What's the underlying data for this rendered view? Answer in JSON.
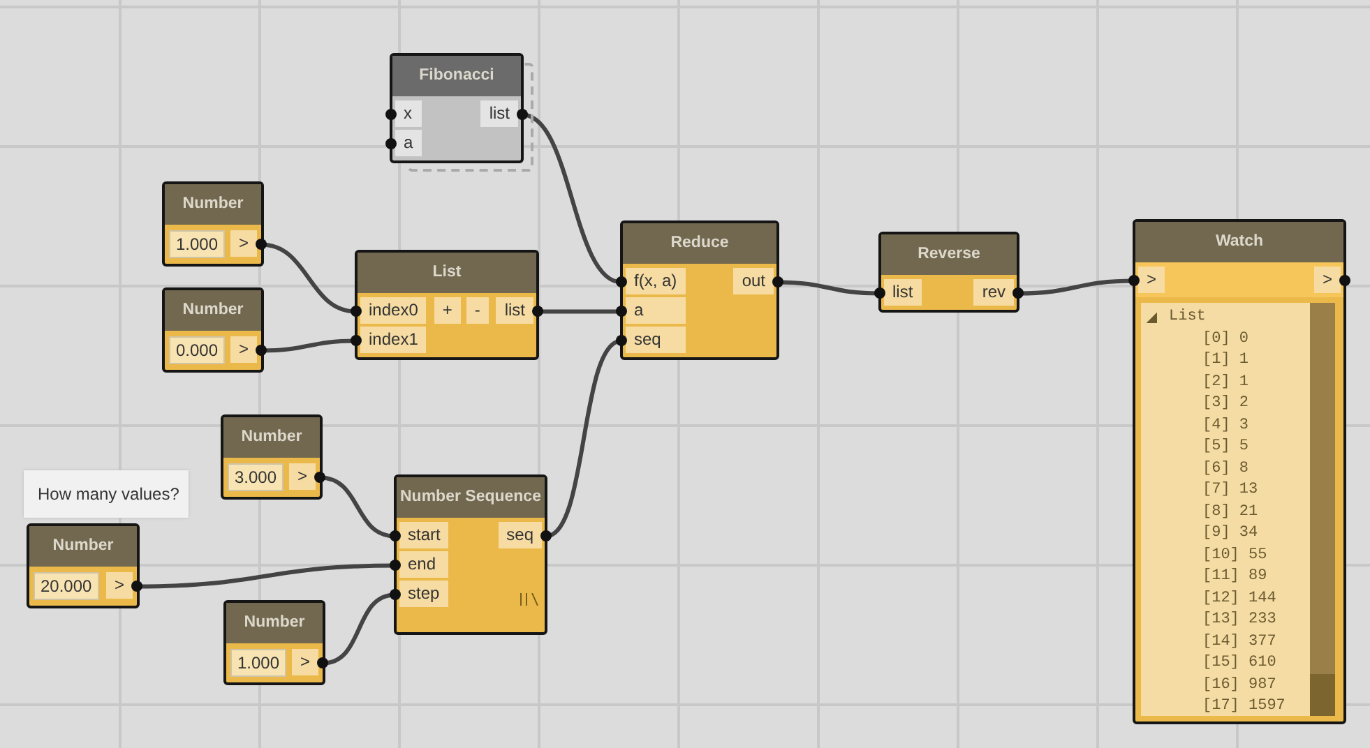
{
  "nodes": [
    {
      "kind": "custom",
      "title": "Fibonacci",
      "inputs": [
        "x",
        "a"
      ],
      "outputs": [
        "list"
      ]
    },
    {
      "kind": "number",
      "title": "Number",
      "value": "1.000",
      "outputs": [
        ">"
      ]
    },
    {
      "kind": "number",
      "title": "Number",
      "value": "0.000",
      "outputs": [
        ">"
      ]
    },
    {
      "kind": "function",
      "title": "List",
      "inputs": [
        "index0",
        "index1"
      ],
      "buttons": [
        "+",
        "-"
      ],
      "outputs": [
        "list"
      ],
      "lacing": false
    },
    {
      "kind": "function",
      "title": "Reduce",
      "inputs": [
        "f(x, a)",
        "a",
        "seq"
      ],
      "outputs": [
        "out"
      ],
      "lacing": false
    },
    {
      "kind": "function",
      "title": "Reverse",
      "inputs": [
        "list"
      ],
      "outputs": [
        "rev"
      ],
      "lacing": false
    },
    {
      "kind": "watch",
      "title": "Watch",
      "inputs": [
        ">"
      ],
      "outputs": [
        ">"
      ],
      "tree": {
        "label": "List",
        "expanded": true,
        "items": [
          "[0] 0",
          "[1] 1",
          "[2] 1",
          "[3] 2",
          "[4] 3",
          "[5] 5",
          "[6] 8",
          "[7] 13",
          "[8] 21",
          "[9] 34",
          "[10] 55",
          "[11] 89",
          "[12] 144",
          "[13] 233",
          "[14] 377",
          "[15] 610",
          "[16] 987",
          "[17] 1597"
        ]
      }
    },
    {
      "kind": "number",
      "title": "Number",
      "value": "3.000",
      "outputs": [
        ">"
      ]
    },
    {
      "kind": "note",
      "text": "How many values?"
    },
    {
      "kind": "number",
      "title": "Number",
      "value": "20.000",
      "outputs": [
        ">"
      ]
    },
    {
      "kind": "function",
      "title": "Number Sequence",
      "inputs": [
        "start",
        "end",
        "step"
      ],
      "outputs": [
        "seq"
      ],
      "lacing": true
    },
    {
      "kind": "number",
      "title": "Number",
      "value": "1.000",
      "outputs": [
        ">"
      ]
    }
  ]
}
